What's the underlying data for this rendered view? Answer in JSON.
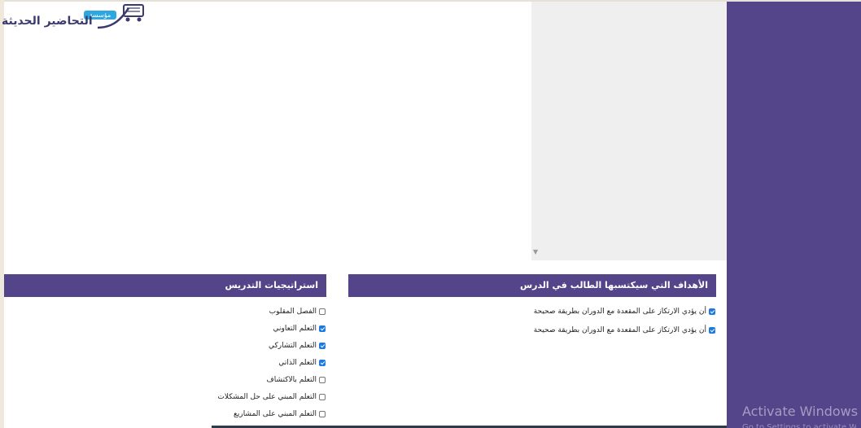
{
  "logo": {
    "text": "التحاضير الحديثة",
    "badge": "مؤسسة"
  },
  "goals": {
    "title": "الأهداف التي سيكتسبها الطالب في الدرس",
    "items": [
      {
        "label": "أن يؤدي الارتكاز على المقعدة مع الدوران بطريقة صحيحة",
        "checked": true
      },
      {
        "label": "أن يؤدي الارتكاز على المقعدة مع الدوران بطريقة صحيحة",
        "checked": true
      }
    ]
  },
  "strategies": {
    "title": "استراتيجيات التدريس",
    "items": [
      {
        "label": "الفصل المقلوب",
        "checked": false
      },
      {
        "label": "التعلم التعاوني",
        "checked": true
      },
      {
        "label": "التعلم التشاركي",
        "checked": true
      },
      {
        "label": "التعلم الذاتي",
        "checked": true
      },
      {
        "label": "التعلم بالاكتشاف",
        "checked": false
      },
      {
        "label": "التعلم المبني على حل المشكلات",
        "checked": false
      },
      {
        "label": "التعلم المبني على المشاريع",
        "checked": false
      }
    ]
  },
  "watermark": {
    "title": "Activate Windows",
    "subtitle": "Go to Settings to activate Windows."
  },
  "colors": {
    "accent": "#54448a",
    "checkbox": "#1f7ae0",
    "panel": "#efefef"
  }
}
